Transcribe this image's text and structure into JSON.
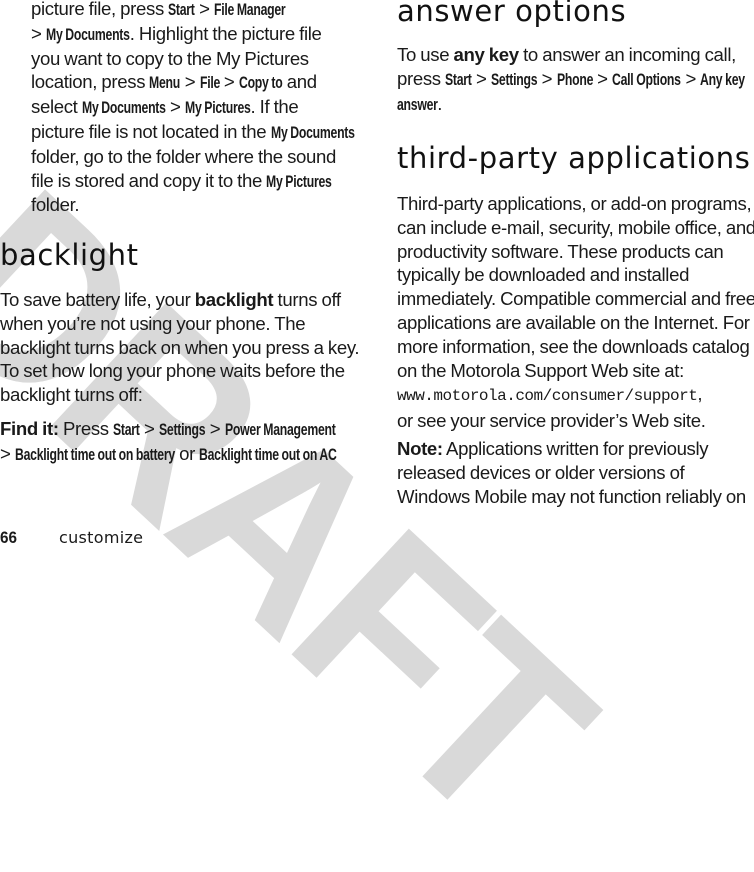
{
  "watermark": "DRAFT",
  "left_column": {
    "intro_lines": [
      [
        {
          "t": "picture file, press "
        },
        {
          "t": "Start",
          "c": 1
        },
        {
          "t": " > "
        },
        {
          "t": "File Manager",
          "c": 1
        }
      ],
      [
        {
          "t": "> "
        },
        {
          "t": "My Documents",
          "c": 1
        },
        {
          "t": ". Highlight the picture file"
        }
      ],
      [
        {
          "t": "you want to copy to the My Pictures"
        }
      ],
      [
        {
          "t": "location, press "
        },
        {
          "t": "Menu",
          "c": 1
        },
        {
          "t": " > "
        },
        {
          "t": "File",
          "c": 1
        },
        {
          "t": " > "
        },
        {
          "t": "Copy to",
          "c": 1
        },
        {
          "t": " and"
        }
      ],
      [
        {
          "t": "select "
        },
        {
          "t": "My Documents",
          "c": 1
        },
        {
          "t": " > "
        },
        {
          "t": "My Pictures",
          "c": 1
        },
        {
          "t": ". If the"
        }
      ],
      [
        {
          "t": "picture file is not located in the "
        },
        {
          "t": "My Documents",
          "c": 1
        }
      ],
      [
        {
          "t": "folder, go to the folder where the sound"
        }
      ],
      [
        {
          "t": "file is stored and copy it to the "
        },
        {
          "t": "My Pictures",
          "c": 1
        }
      ],
      [
        {
          "t": "folder."
        }
      ]
    ],
    "backlight": {
      "heading": "backlight",
      "lines": [
        [
          {
            "t": "To save battery life, your "
          },
          {
            "t": "backlight",
            "b": 1
          },
          {
            "t": " turns off"
          }
        ],
        [
          {
            "t": "when you’re not using your phone. The"
          }
        ],
        [
          {
            "t": "backlight turns back on when you press a key."
          }
        ],
        [
          {
            "t": "To set how long your phone waits before the"
          }
        ],
        [
          {
            "t": "backlight turns off:"
          }
        ]
      ],
      "find_it_lines": [
        [
          {
            "t": "Find it:",
            "b": 1
          },
          {
            "t": " Press "
          },
          {
            "t": "Start",
            "c": 1
          },
          {
            "t": " > "
          },
          {
            "t": "Settings",
            "c": 1
          },
          {
            "t": " > "
          },
          {
            "t": "Power Management",
            "c": 1
          }
        ],
        [
          {
            "t": "> "
          },
          {
            "t": "Backlight time out on battery",
            "c": 1
          },
          {
            "t": " or "
          },
          {
            "t": "Backlight time out on AC",
            "c": 1
          }
        ]
      ]
    }
  },
  "right_column": {
    "answer_options": {
      "heading": "answer options",
      "lines": [
        [
          {
            "t": "To use "
          },
          {
            "t": "any key",
            "b": 1
          },
          {
            "t": " to answer an incoming call,"
          }
        ],
        [
          {
            "t": "press "
          },
          {
            "t": "Start",
            "c": 1
          },
          {
            "t": " > "
          },
          {
            "t": "Settings",
            "c": 1
          },
          {
            "t": " > "
          },
          {
            "t": "Phone",
            "c": 1
          },
          {
            "t": " > "
          },
          {
            "t": "Call Options",
            "c": 1
          },
          {
            "t": " > "
          },
          {
            "t": "Any key",
            "c": 1
          }
        ],
        [
          {
            "t": "answer",
            "c": 1
          },
          {
            "t": "."
          }
        ]
      ]
    },
    "third_party": {
      "heading": "third-party applications",
      "lines": [
        [
          {
            "t": "Third-party applications, or add-on programs,"
          }
        ],
        [
          {
            "t": "can include e-mail, security, mobile office, and"
          }
        ],
        [
          {
            "t": "productivity software. These products can"
          }
        ],
        [
          {
            "t": "typically be downloaded and installed"
          }
        ],
        [
          {
            "t": "immediately. Compatible commercial and free"
          }
        ],
        [
          {
            "t": "applications are available on the Internet. For"
          }
        ],
        [
          {
            "t": "more information, see the downloads catalog"
          }
        ],
        [
          {
            "t": "on the Motorola Support Web site at:"
          }
        ],
        [
          {
            "t": "www.motorola.com/consumer/support",
            "m": 1
          },
          {
            "t": ","
          }
        ],
        [
          {
            "t": "or see your service provider’s Web site."
          }
        ]
      ],
      "note_lines": [
        [
          {
            "t": "Note:",
            "b": 1
          },
          {
            "t": " Applications written for previously"
          }
        ],
        [
          {
            "t": "released devices or older versions of"
          }
        ],
        [
          {
            "t": "Windows Mobile may not function reliably on"
          }
        ]
      ]
    }
  },
  "footer": {
    "page_number": "66",
    "section": "customize"
  }
}
